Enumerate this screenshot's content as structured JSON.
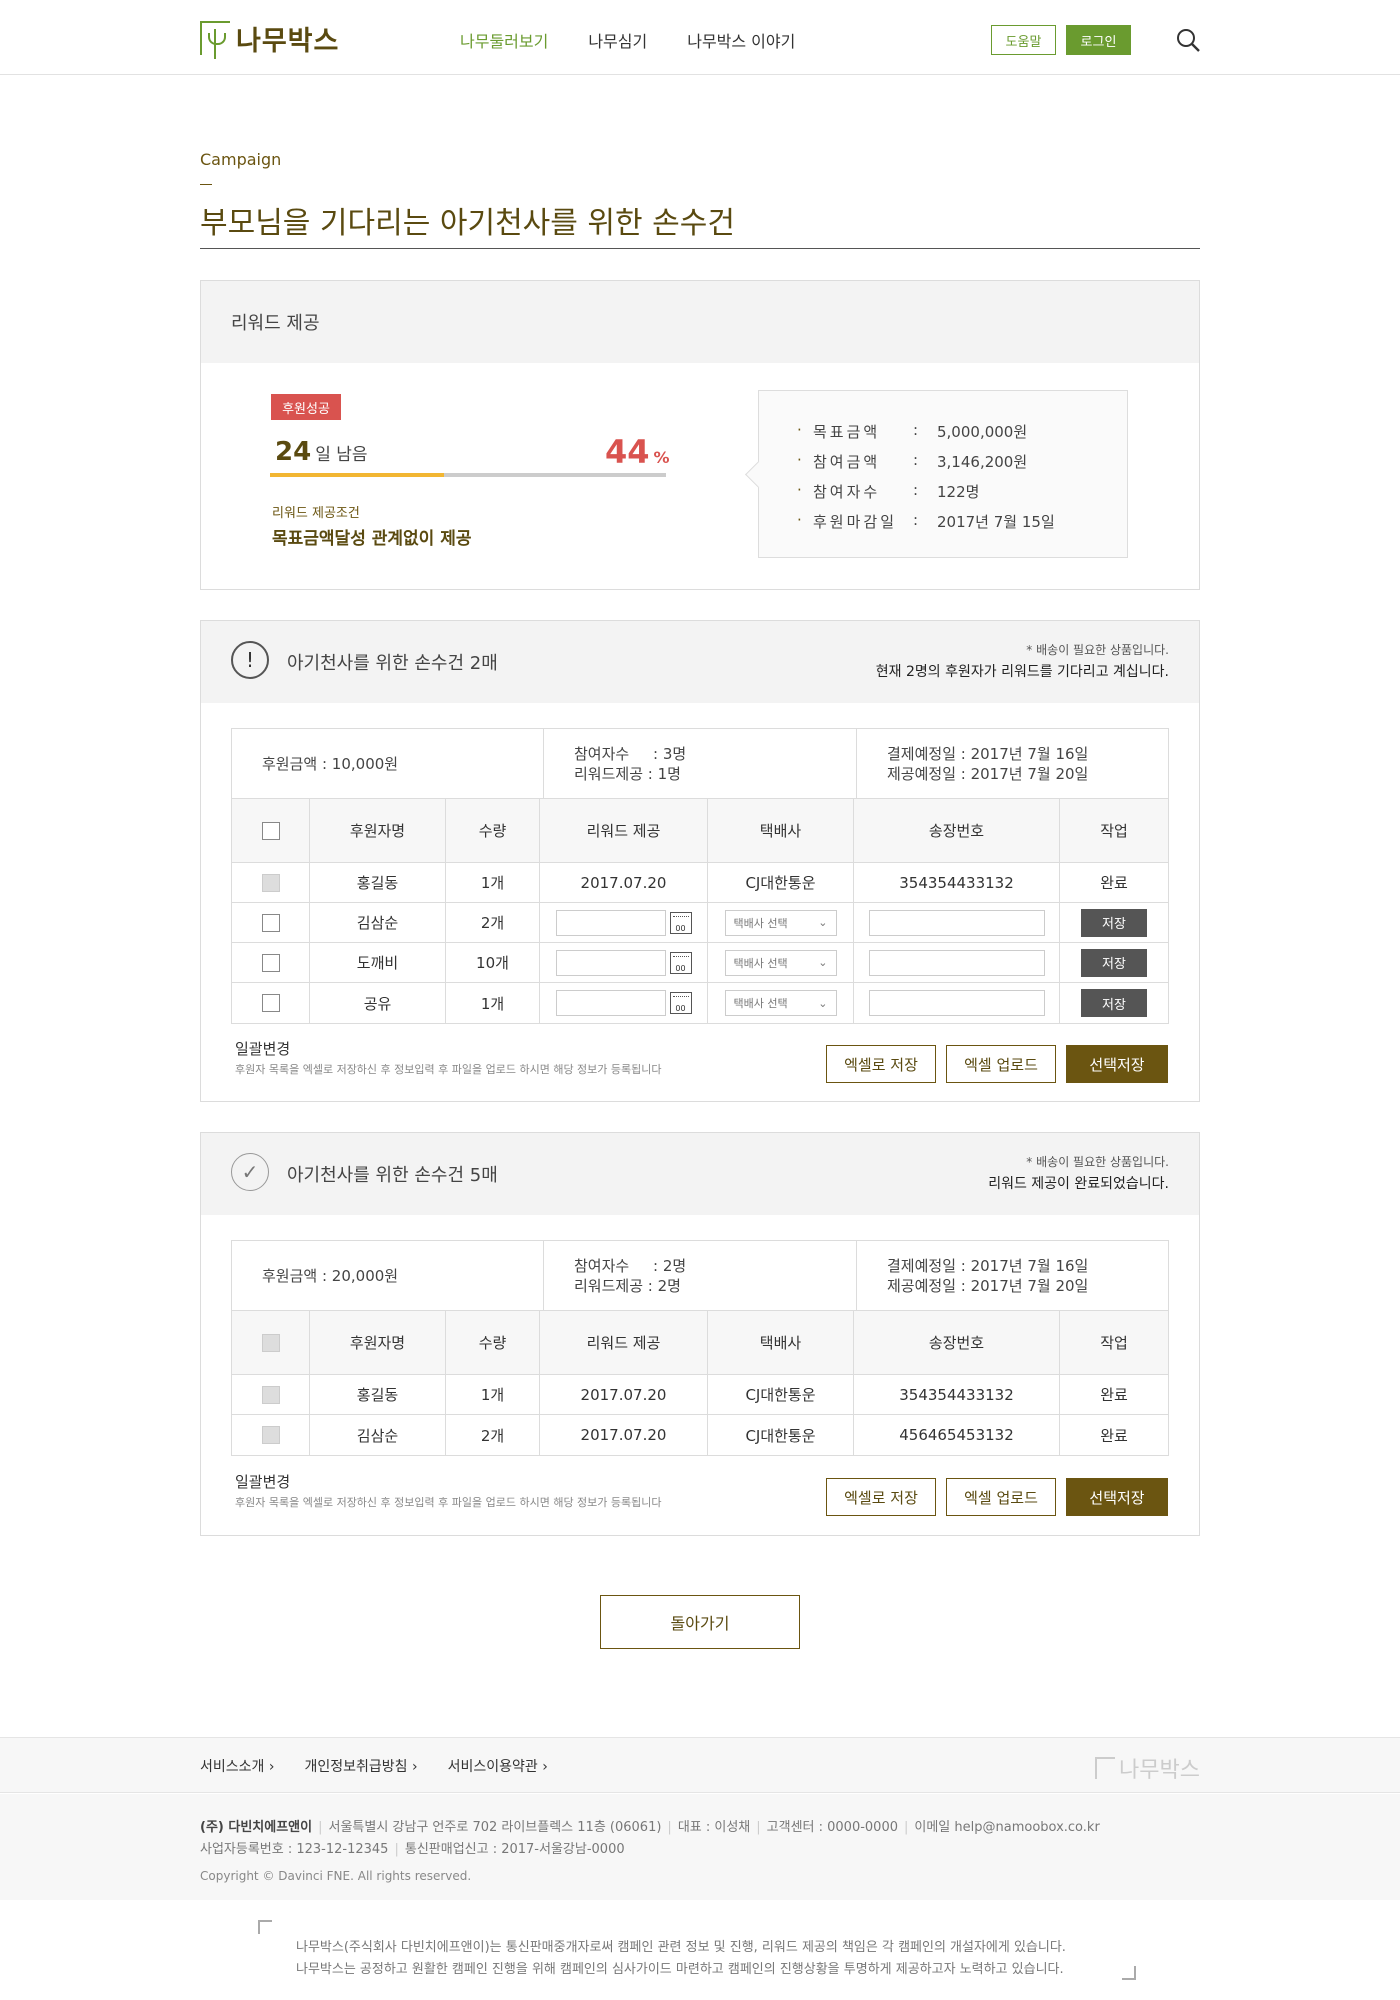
{
  "header": {
    "logo_text": "나무박스",
    "nav": [
      "나무둘러보기",
      "나무심기",
      "나무박스 이야기"
    ],
    "help_label": "도움말",
    "login_label": "로그인"
  },
  "page": {
    "category": "Campaign",
    "title": "부모님을 기다리는 아기천사를 위한 손수건"
  },
  "summary": {
    "heading": "리워드 제공",
    "status_badge": "후원성공",
    "days_num": "24",
    "days_unit": "일 남음",
    "percent_num": "44",
    "percent_unit": "%",
    "progress": 0.44,
    "condition_label": "리워드 제공조건",
    "condition_value": "목표금액달성 관계없이 제공",
    "info": [
      {
        "key": "목표금액",
        "value": "5,000,000원"
      },
      {
        "key": "참여금액",
        "value": "3,146,200원"
      },
      {
        "key": "참여자수",
        "value": "122명"
      },
      {
        "key": "후원마감일",
        "value": "2017년 7월 15일"
      }
    ]
  },
  "table_headers": [
    "후원자명",
    "수량",
    "리워드 제공",
    "택배사",
    "송장번호",
    "작업"
  ],
  "rewards": [
    {
      "title": "아기천사를 위한 손수건 2매",
      "note": "* 배송이 필요한 상품입니다.",
      "message": "현재 2명의 후원자가 리워드를 기다리고 계십니다.",
      "amount": "후원금액 : 10,000원",
      "participants": "참여자수     : 3명",
      "reward_count": "리워드제공 : 1명",
      "pay_date": "결제예정일 : 2017년 7월 16일",
      "ship_date": "제공예정일 : 2017년 7월 20일",
      "rows": [
        {
          "name": "홍길동",
          "qty": "1개",
          "date": "2017.07.20",
          "courier": "CJ대한통운",
          "tracking": "354354433132",
          "action": "완료",
          "done": true
        },
        {
          "name": "김삼순",
          "qty": "2개",
          "courier_placeholder": "택배사 선택",
          "action": "저장",
          "done": false
        },
        {
          "name": "도깨비",
          "qty": "10개",
          "courier_placeholder": "택배사 선택",
          "action": "저장",
          "done": false
        },
        {
          "name": "공유",
          "qty": "1개",
          "courier_placeholder": "택배사 선택",
          "action": "저장",
          "done": false
        }
      ],
      "bulk_title": "일괄변경",
      "bulk_desc": "후원자 목록을 엑셀로 저장하신 후 정보입력 후 파일을 업로드 하시면 해당 정보가 등록됩니다",
      "btn_excel_save": "엑셀로 저장",
      "btn_excel_upload": "엑셀 업로드",
      "btn_selected_save": "선택저장"
    },
    {
      "title": "아기천사를 위한 손수건 5매",
      "note": "* 배송이 필요한 상품입니다.",
      "message": "리워드 제공이 완료되었습니다.",
      "amount": "후원금액 : 20,000원",
      "participants": "참여자수     : 2명",
      "reward_count": "리워드제공 : 2명",
      "pay_date": "결제예정일 : 2017년 7월 16일",
      "ship_date": "제공예정일 : 2017년 7월 20일",
      "rows": [
        {
          "name": "홍길동",
          "qty": "1개",
          "date": "2017.07.20",
          "courier": "CJ대한통운",
          "tracking": "354354433132",
          "action": "완료",
          "done": true
        },
        {
          "name": "김삼순",
          "qty": "2개",
          "date": "2017.07.20",
          "courier": "CJ대한통운",
          "tracking": "456465453132",
          "action": "완료",
          "done": true
        }
      ],
      "bulk_title": "일괄변경",
      "bulk_desc": "후원자 목록을 엑셀로 저장하신 후 정보입력 후 파일을 업로드 하시면 해당 정보가 등록됩니다",
      "btn_excel_save": "엑셀로 저장",
      "btn_excel_upload": "엑셀 업로드",
      "btn_selected_save": "선택저장"
    }
  ],
  "back_label": "돌아가기",
  "footer": {
    "links": [
      "서비스소개",
      "개인정보취급방침",
      "서비스이용약관"
    ],
    "logo_text": "나무박스",
    "company": "(주) 다빈치에프앤이",
    "address": "서울특별시 강남구 언주로 702 라이브플렉스 11층 (06061)",
    "ceo": "대표 : 이성채",
    "center": "고객센터 : 0000-0000",
    "email": "이메일 help@namoobox.co.kr",
    "biz_no": "사업자등록번호 : 123-12-12345",
    "mail_order": "통신판매업신고 : 2017-서울강남-0000",
    "copyright": "Copyright © Davinci FNE. All rights reserved.",
    "disclaimer1": "나무박스(주식회사 다빈치에프앤이)는 통신판매중개자로써 캠페인 관련 정보 및 진행, 리워드 제공의 책임은 각 캠페인의 개설자에게 있습니다.",
    "disclaimer2": "나무박스는 공정하고 원활한 캠페인 진행을 위해 캠페인의 심사가이드 마련하고 캠페인의 진행상황을 투명하게 제공하고자 노력하고 있습니다."
  }
}
